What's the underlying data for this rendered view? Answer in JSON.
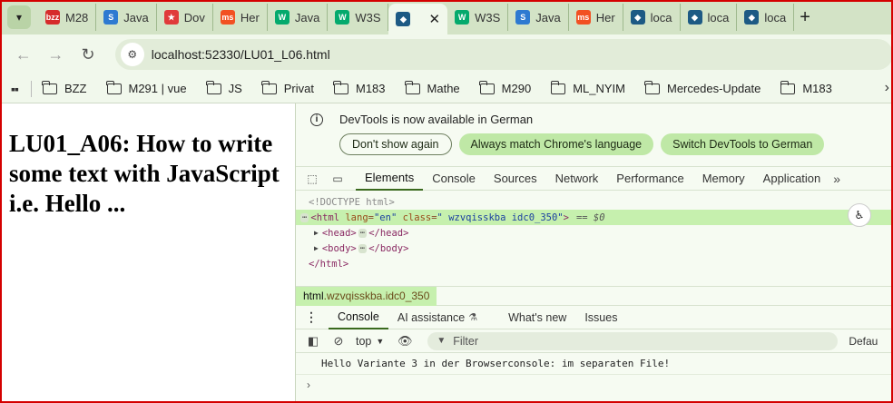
{
  "tabstrip": {
    "menu_icon": "chevron-down-icon",
    "tabs": [
      {
        "label": "M28",
        "favicon": "bzz",
        "color": "#d62b2b",
        "active": false
      },
      {
        "label": "Java",
        "favicon": "S",
        "color": "#2e7ad1",
        "active": false
      },
      {
        "label": "Dov",
        "favicon": "★",
        "color": "#e03a3a",
        "active": false
      },
      {
        "label": "Her",
        "favicon": "ms",
        "color": "#f25022",
        "active": false
      },
      {
        "label": "Java",
        "favicon": "W",
        "color": "#04aa6d",
        "active": false
      },
      {
        "label": "W3S",
        "favicon": "W",
        "color": "#04aa6d",
        "active": false
      },
      {
        "label": "",
        "favicon": "◆",
        "color": "#1d5a84",
        "active": true
      },
      {
        "label": "W3S",
        "favicon": "W",
        "color": "#04aa6d",
        "active": false
      },
      {
        "label": "Java",
        "favicon": "S",
        "color": "#2e7ad1",
        "active": false
      },
      {
        "label": "Her",
        "favicon": "ms",
        "color": "#f25022",
        "active": false
      },
      {
        "label": "loca",
        "favicon": "◆",
        "color": "#1d5a84",
        "active": false
      },
      {
        "label": "loca",
        "favicon": "◆",
        "color": "#1d5a84",
        "active": false
      },
      {
        "label": "loca",
        "favicon": "◆",
        "color": "#1d5a84",
        "active": false
      }
    ],
    "close_symbol": "✕",
    "new_tab_symbol": "+"
  },
  "toolbar": {
    "back": "←",
    "forward": "→",
    "reload": "↻",
    "url": "localhost:52330/LU01_L06.html",
    "site_info_icon": "⚙"
  },
  "bookmarks": {
    "items": [
      "BZZ",
      "M291 | vue",
      "JS",
      "Privat",
      "M183",
      "Mathe",
      "M290",
      "ML_NYIM",
      "Mercedes-Update",
      "M183"
    ],
    "more_symbol": "›"
  },
  "page": {
    "heading": "LU01_A06: How to write some text with JavaScript i.e. Hello ..."
  },
  "devtools": {
    "infobar": {
      "message": "DevTools is now available in German",
      "buttons": [
        "Don't show again",
        "Always match Chrome's language",
        "Switch DevTools to German"
      ]
    },
    "tabs": [
      "Elements",
      "Console",
      "Sources",
      "Network",
      "Performance",
      "Memory",
      "Application"
    ],
    "more_tabs": "»",
    "elements": {
      "doctype": "<!DOCTYPE html>",
      "html_tag_open": "<html",
      "lang_attr": "lang",
      "lang_val": "\"en\"",
      "class_attr": "class",
      "class_val": "\" wzvqisskba idc0_350\"",
      "html_tag_close": ">",
      "selected_marker": "== $0",
      "head_open": "<head>",
      "head_close": "</head>",
      "body_open": "<body>",
      "body_close": "</body>",
      "html_end": "</html>",
      "ellipsis": "⋯"
    },
    "breadcrumb": {
      "tag": "html",
      "classes": ".wzvqisskba.idc0_350"
    },
    "drawer": {
      "tabs": [
        "Console",
        "AI assistance",
        "What's new",
        "Issues"
      ],
      "flask": "⚗"
    },
    "console_toolbar": {
      "context": "top",
      "filter_placeholder": "Filter",
      "levels": "Defau"
    },
    "console": {
      "message": "Hello Variante 3 in der Browserconsole: im separaten File!",
      "prompt": "›"
    }
  }
}
